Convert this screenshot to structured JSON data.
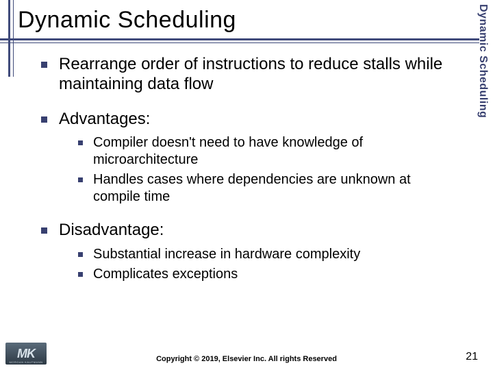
{
  "title": "Dynamic Scheduling",
  "sidebar_label": "Dynamic Scheduling",
  "bullets": [
    {
      "text": "Rearrange order of instructions to reduce stalls while maintaining data flow",
      "children": []
    },
    {
      "text": "Advantages:",
      "children": [
        "Compiler doesn't need to have knowledge of microarchitecture",
        "Handles cases where dependencies are unknown at compile time"
      ]
    },
    {
      "text": "Disadvantage:",
      "children": [
        "Substantial increase in hardware complexity",
        "Complicates exceptions"
      ]
    }
  ],
  "footer": "Copyright © 2019, Elsevier Inc. All rights Reserved",
  "page_number": "21",
  "logo": {
    "initials": "MK",
    "publisher": "MORGAN KAUFMANN"
  }
}
